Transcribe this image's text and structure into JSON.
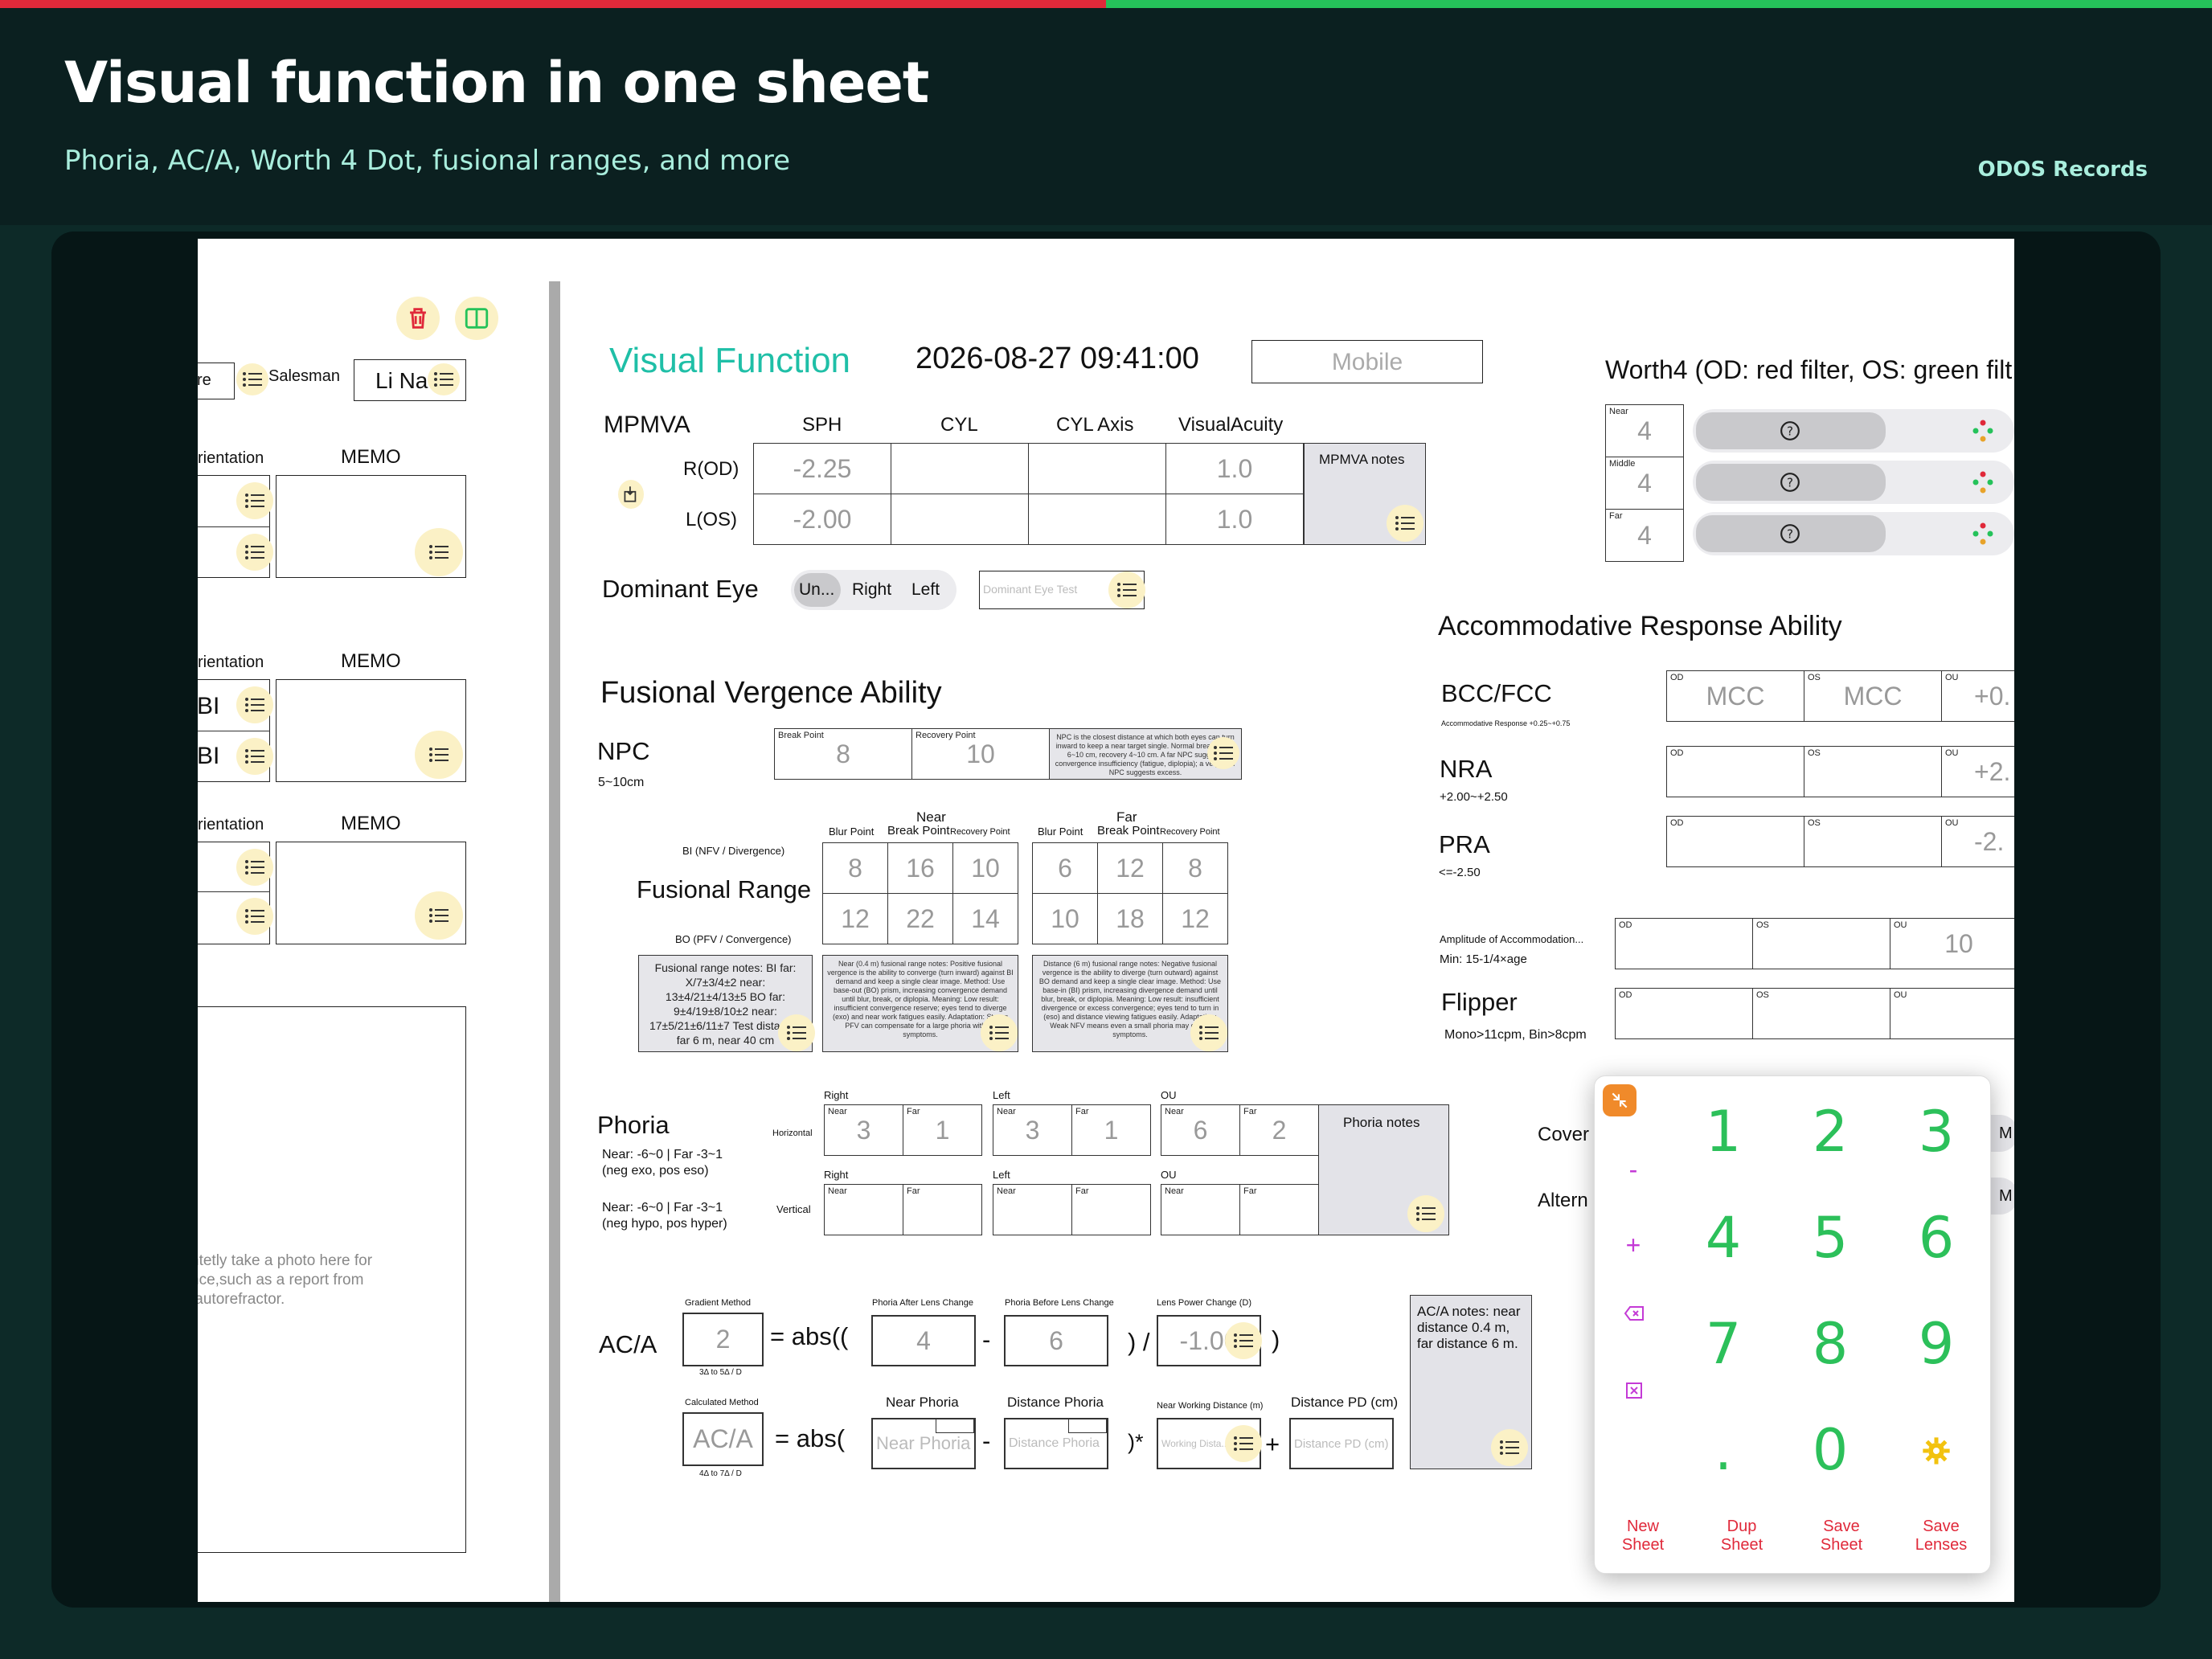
{
  "hero": {
    "title": "Visual function in one sheet",
    "subtitle": "Phoria, AC/A, Worth 4 Dot, fusional ranges, and more",
    "brand": "ODOS Records"
  },
  "left_panel": {
    "partial_label": "re",
    "salesman_label": "Salesman",
    "salesman_value": "Li Na",
    "orientation_label": "rientation",
    "memo_label": "MEMO",
    "bi_label": "BI",
    "photo_hint": "ntetly take a photo here for\nnce,such as a report from\n autorefractor."
  },
  "header": {
    "title": "Visual Function",
    "datetime": "2026-08-27 09:41:00",
    "mobile_placeholder": "Mobile"
  },
  "mpmva": {
    "label": "MPMVA",
    "columns": [
      "SPH",
      "CYL",
      "CYL Axis",
      "VisualAcuity"
    ],
    "rows": [
      {
        "eye": "R(OD)",
        "sph": "-2.25",
        "cyl": "",
        "axis": "",
        "va": "1.0"
      },
      {
        "eye": "L(OS)",
        "sph": "-2.00",
        "cyl": "",
        "axis": "",
        "va": "1.0"
      }
    ],
    "notes": "MPMVA notes"
  },
  "dominant_eye": {
    "label": "Dominant Eye",
    "options": [
      "Un...",
      "Right",
      "Left"
    ],
    "selected": "Un...",
    "test_placeholder": "Dominant Eye Test"
  },
  "worth4": {
    "title": "Worth4 (OD: red filter, OS: green filt",
    "rows": [
      {
        "caption": "Near",
        "value": "4"
      },
      {
        "caption": "Middle",
        "value": "4"
      },
      {
        "caption": "Far",
        "value": "4"
      }
    ]
  },
  "fusional": {
    "title": "Fusional Vergence Ability",
    "npc_label": "NPC",
    "npc_range": "5~10cm",
    "break_caption": "Break Point",
    "break_value": "8",
    "recovery_caption": "Recovery Point",
    "recovery_value": "10",
    "npc_note": "NPC is the closest distance at which both eyes can turn inward to keep a near target single. Normal break within 6~10 cm, recovery 4~10 cm. A far NPC suggests convergence insufficiency (fatigue, diplopia); a very near NPC suggests excess.",
    "near_label": "Near",
    "far_label": "Far",
    "col_captions": [
      "Blur Point",
      "Break Point",
      "Recovery Point"
    ],
    "range_label": "Fusional Range",
    "bi_label": "BI (NFV / Divergence)",
    "bo_label": "BO (PFV / Convergence)",
    "near_bi": [
      "8",
      "16",
      "10"
    ],
    "near_bo": [
      "12",
      "22",
      "14"
    ],
    "far_bi": [
      "6",
      "12",
      "8"
    ],
    "far_bo": [
      "10",
      "18",
      "12"
    ],
    "range_note": "Fusional range notes: BI far: X/7±3/4±2 near: 13±4/21±4/13±5    BO far: 9±4/19±8/10±2 near: 17±5/21±6/11±7  Test distance: far 6 m, near 40 cm",
    "near_note": "Near (0.4 m) fusional range notes: Positive fusional vergence is the ability to converge (turn inward) against BI demand and keep a single clear image. Method: Use base-out (BO) prism, increasing convergence demand until blur, break, or diplopia. Meaning: Low result: insufficient convergence reserve; eyes tend to diverge (exo) and near work fatigues easily. Adaptation: Strong PFV can compensate for a large phoria without symptoms.",
    "far_note": "Distance (6 m) fusional range notes: Negative fusional vergence is the ability to diverge (turn outward) against BO demand and keep a single clear image. Method: Use base-in (BI) prism, increasing divergence demand until blur, break, or diplopia. Meaning: Low result: insufficient divergence or excess convergence; eyes tend to turn in (eso) and distance viewing fatigues easily. Adaptation: Weak NFV means even a small phoria may cause symptoms."
  },
  "phoria": {
    "label": "Phoria",
    "horizontal_norm": "Near: -6~0 | Far -3~1\n(neg exo, pos eso)",
    "vertical_norm": "Near: -6~0 | Far -3~1\n(neg hypo, pos hyper)",
    "horizontal_label": "Horizontal",
    "vertical_label": "Vertical",
    "groups": [
      "Right",
      "Left",
      "OU"
    ],
    "near_caption": "Near",
    "far_caption": "Far",
    "horizontal": [
      [
        "3",
        "1"
      ],
      [
        "3",
        "1"
      ],
      [
        "6",
        "2"
      ]
    ],
    "notes": "Phoria notes"
  },
  "aca": {
    "label": "AC/A",
    "gradient_caption": "Gradient Method",
    "gradient_value": "2",
    "gradient_norm": "3Δ to 5Δ / D",
    "after_caption": "Phoria After Lens Change",
    "after_value": "4",
    "before_caption": "Phoria Before Lens Change",
    "before_value": "6",
    "power_caption": "Lens Power Change (D)",
    "power_value": "-1.00",
    "eq_abs": "= abs((",
    "calc_caption": "Calculated Method",
    "calc_placeholder": "AC/A",
    "calc_norm": "4Δ to 7Δ / D",
    "eq_abs2": "= abs(",
    "near_phoria_label": "Near Phoria",
    "near_phoria_placeholder": "Near Phoria",
    "dist_phoria_label": "Distance Phoria",
    "dist_phoria_placeholder": "Distance Phoria",
    "nwd_caption": "Near Working Distance (m)",
    "nwd_placeholder": "Working Dista...",
    "pd_label": "Distance PD (cm)",
    "pd_placeholder": "Distance PD (cm)",
    "notes": "AC/A notes: near distance 0.4 m, far distance 6 m."
  },
  "accommodative": {
    "title": "Accommodative Response Ability",
    "bcc_label": "BCC/FCC",
    "bcc_sub": "Accommodative Response +0.25~+0.75",
    "bcc_od": "MCC",
    "bcc_os": "MCC",
    "bcc_ou": "+0.",
    "nra_label": "NRA",
    "nra_sub": "+2.00~+2.50",
    "nra_ou": "+2.",
    "pra_label": "PRA",
    "pra_sub": "<=-2.50",
    "pra_ou": "-2.",
    "amp_label": "Amplitude of Accommodation...",
    "amp_sub": "Min: 15-1/4×age",
    "amp_ou": "10",
    "flipper_label": "Flipper",
    "flipper_sub": "Mono>11cpm, Bin>8cpm",
    "od": "OD",
    "os": "OS",
    "ou": "OU"
  },
  "cover": {
    "cover_label": "Cover",
    "altern_label": "Altern",
    "m1": "M",
    "m2": "M"
  },
  "keypad": {
    "keys": [
      "1",
      "2",
      "3",
      "4",
      "5",
      "6",
      "7",
      "8",
      "9",
      ".",
      "0"
    ],
    "minus": "-",
    "plus": "+",
    "actions": [
      "New\nSheet",
      "Dup\nSheet",
      "Save\nSheet",
      "Save\nLenses"
    ],
    "accent": "#2cc05a"
  },
  "colors": {
    "teal": "#1fbfa7",
    "red": "#e0293a",
    "green": "#25c25a",
    "yellow": "#fbf1c6"
  }
}
